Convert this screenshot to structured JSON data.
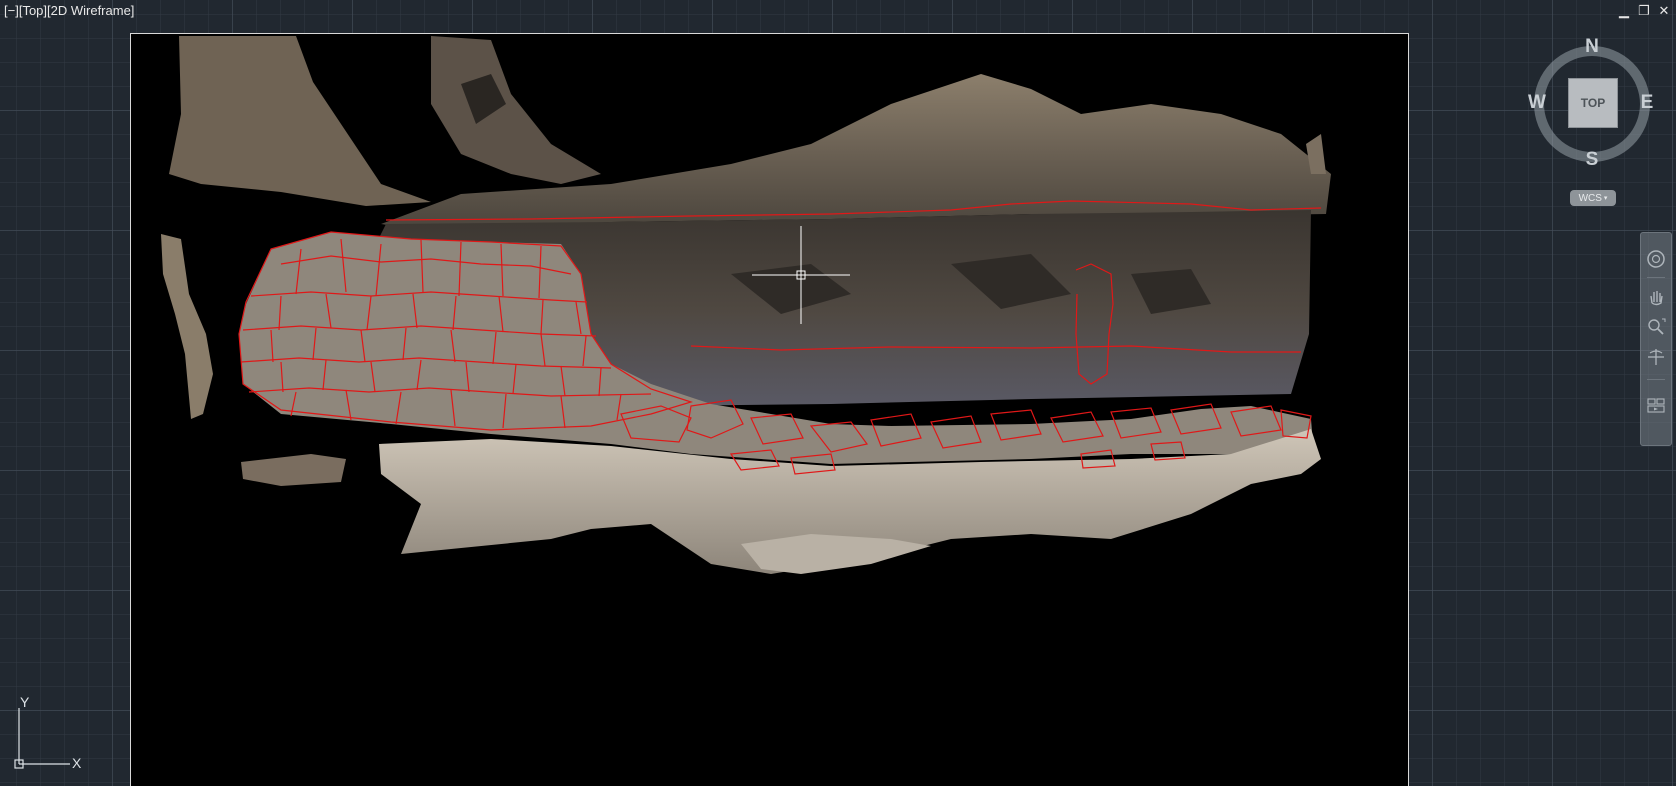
{
  "viewport": {
    "label_segments": [
      "[−]",
      "[Top]",
      "[2D Wireframe]"
    ]
  },
  "window_controls": {
    "minimize": "▁",
    "restore": "❐",
    "close": "✕"
  },
  "viewcube": {
    "north": "N",
    "south": "S",
    "east": "E",
    "west": "W",
    "face": "TOP"
  },
  "ucs_menu": {
    "label": "WCS",
    "caret": "▾"
  },
  "navigation_bar": {
    "tools": [
      "steering-wheel-icon",
      "pan-icon",
      "zoom-icon",
      "orbit-icon",
      "showmotion-icon"
    ]
  },
  "ucs_icon": {
    "x_label": "X",
    "y_label": "Y"
  },
  "colors": {
    "background": "#212830",
    "model_background": "#000000",
    "polyline": "#e01818",
    "frame": "#d9d9d9"
  }
}
